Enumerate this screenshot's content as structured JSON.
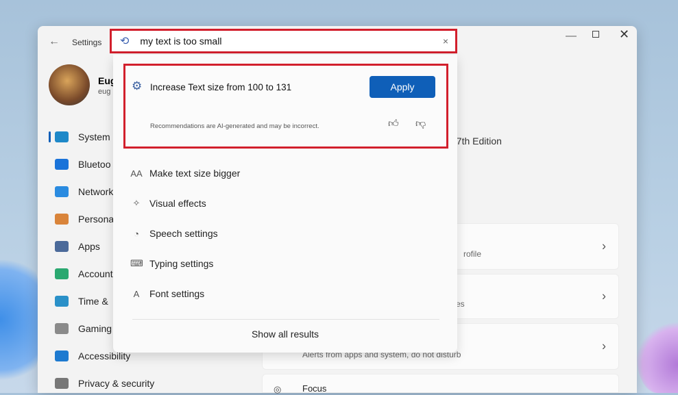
{
  "window": {
    "title": "Settings",
    "controls": [
      "minimize",
      "maximize",
      "close"
    ]
  },
  "search": {
    "value": "my text is too small",
    "clear": "×"
  },
  "user": {
    "name": "Eug",
    "email": "eug"
  },
  "sidebar": {
    "items": [
      {
        "label": "System",
        "color": "#1e88c8"
      },
      {
        "label": "Bluetoo",
        "color": "#1a73d9"
      },
      {
        "label": "Network",
        "color": "#2a8be0"
      },
      {
        "label": "Persona",
        "color": "#d9843a"
      },
      {
        "label": "Apps",
        "color": "#4b6a9a"
      },
      {
        "label": "Account",
        "color": "#2aa870"
      },
      {
        "label": "Time &",
        "color": "#2a90c8"
      },
      {
        "label": "Gaming",
        "color": "#8a8a8a"
      },
      {
        "label": "Accessibility",
        "color": "#1e7ad0"
      },
      {
        "label": "Privacy & security",
        "color": "#777"
      }
    ]
  },
  "main": {
    "edition": ", 7th Edition",
    "cards": [
      {
        "sub": "rofile"
      },
      {
        "sub": "es"
      },
      {
        "sub": "Alerts from apps and system, do not disturb"
      },
      {
        "title": "Focus"
      }
    ]
  },
  "recommendation": {
    "text": "Increase Text size from 100 to 131",
    "apply": "Apply",
    "disclaimer": "Recommendations are AI-generated and may be incorrect.",
    "accent": "#0f5fb8"
  },
  "results": [
    {
      "icon": "AA",
      "label": "Make text size bigger"
    },
    {
      "icon": "✧",
      "label": "Visual effects"
    },
    {
      "icon": "◔",
      "label": "Speech settings"
    },
    {
      "icon": "⌨",
      "label": "Typing settings"
    },
    {
      "icon": "A",
      "label": "Font settings"
    }
  ],
  "show_all": "Show all results"
}
